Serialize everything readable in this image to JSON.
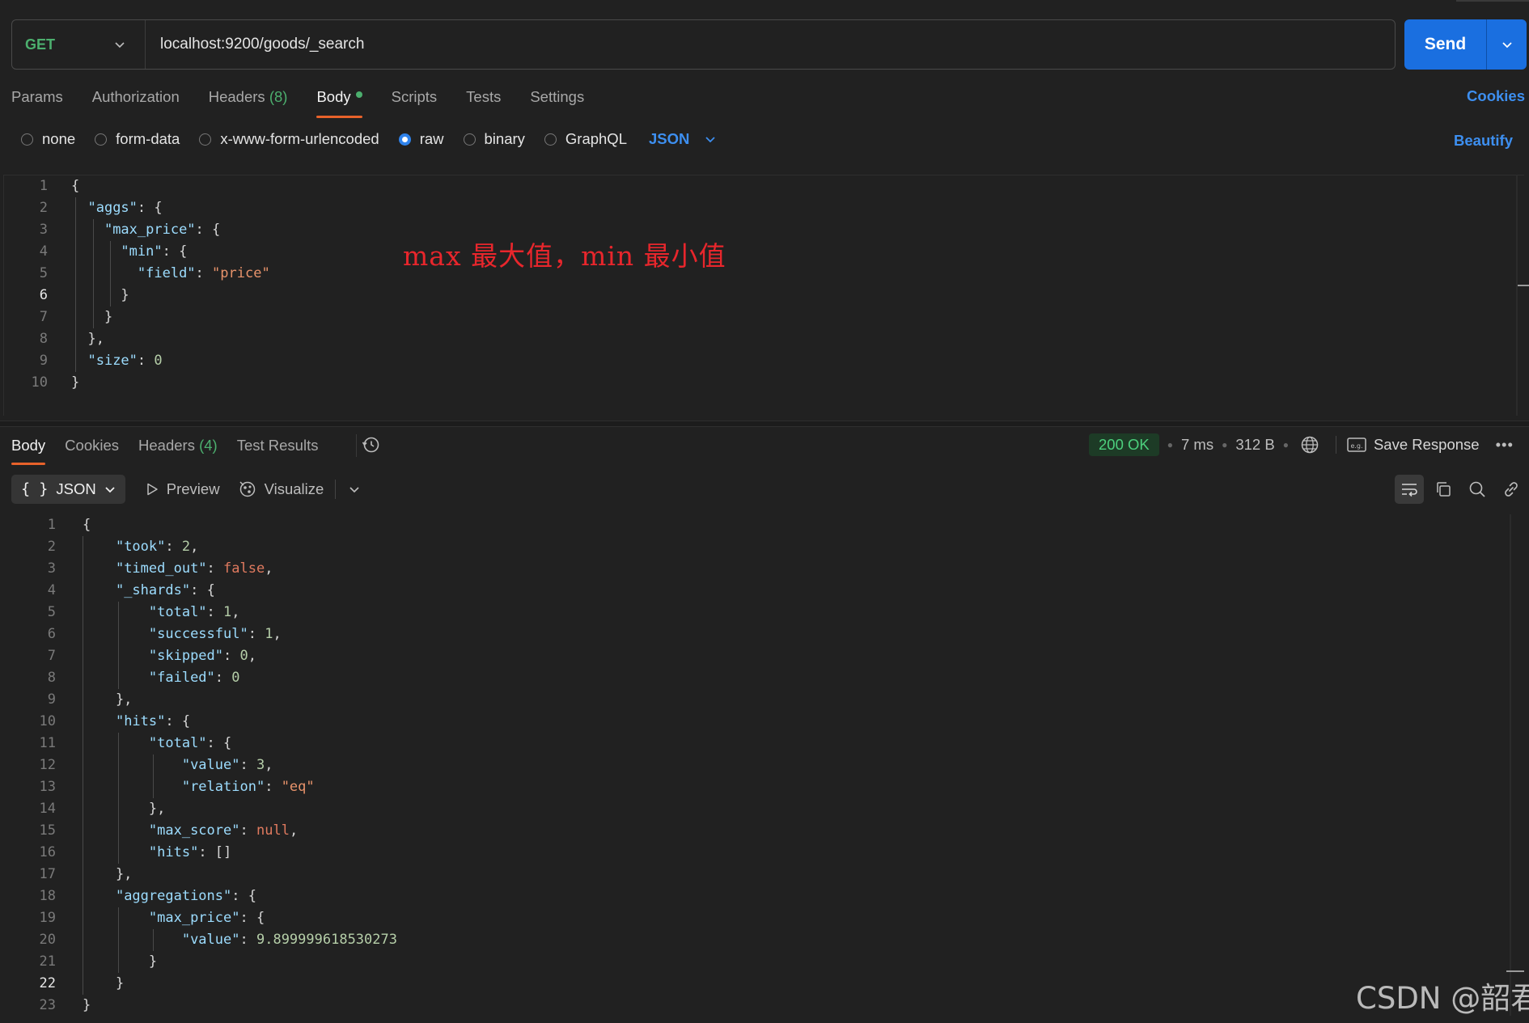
{
  "request": {
    "method": "GET",
    "url": "localhost:9200/goods/_search",
    "send_label": "Send",
    "tabs": [
      {
        "label": "Params",
        "count": ""
      },
      {
        "label": "Authorization",
        "count": ""
      },
      {
        "label": "Headers",
        "count": "(8)"
      },
      {
        "label": "Body",
        "count": ""
      },
      {
        "label": "Scripts",
        "count": ""
      },
      {
        "label": "Tests",
        "count": ""
      },
      {
        "label": "Settings",
        "count": ""
      }
    ],
    "active_tab": "Body",
    "cookies_label": "Cookies",
    "body_types": [
      "none",
      "form-data",
      "x-www-form-urlencoded",
      "raw",
      "binary",
      "GraphQL"
    ],
    "selected_body_type": "raw",
    "language": "JSON",
    "beautify_label": "Beautify",
    "body_lines": [
      "{",
      "  \"aggs\": {",
      "    \"max_price\": {",
      "      \"min\": {",
      "        \"field\": \"price\"",
      "      }",
      "    }",
      "  },",
      "  \"size\": 0",
      "}"
    ],
    "current_line": 6,
    "annotation": "max 最大值，min 最小值"
  },
  "response": {
    "tabs": [
      {
        "label": "Body",
        "count": ""
      },
      {
        "label": "Cookies",
        "count": ""
      },
      {
        "label": "Headers",
        "count": "(4)"
      },
      {
        "label": "Test Results",
        "count": ""
      }
    ],
    "active_tab": "Body",
    "status": "200 OK",
    "time": "7 ms",
    "size": "312 B",
    "save_label": "Save Response",
    "more_label": "•••",
    "format": "JSON",
    "format_brace": "{ }",
    "preview_label": "Preview",
    "visualize_label": "Visualize",
    "body_lines": [
      "{",
      "    \"took\": 2,",
      "    \"timed_out\": false,",
      "    \"_shards\": {",
      "        \"total\": 1,",
      "        \"successful\": 1,",
      "        \"skipped\": 0,",
      "        \"failed\": 0",
      "    },",
      "    \"hits\": {",
      "        \"total\": {",
      "            \"value\": 3,",
      "            \"relation\": \"eq\"",
      "        },",
      "        \"max_score\": null,",
      "        \"hits\": []",
      "    },",
      "    \"aggregations\": {",
      "        \"max_price\": {",
      "            \"value\": 9.899999618530273",
      "        }",
      "    }",
      "}"
    ],
    "current_line": 22
  },
  "watermark": "CSDN @韶君",
  "colors": {
    "background": "#212121",
    "accent_blue": "#1a6fe0",
    "get_green": "#4caf6e",
    "active_tab_underline": "#e8622a",
    "json_key": "#9cdcfe",
    "json_string": "#e8936b",
    "json_number": "#b5cea8",
    "json_literal": "#e07a5f",
    "annotation_red": "#e8262c"
  }
}
